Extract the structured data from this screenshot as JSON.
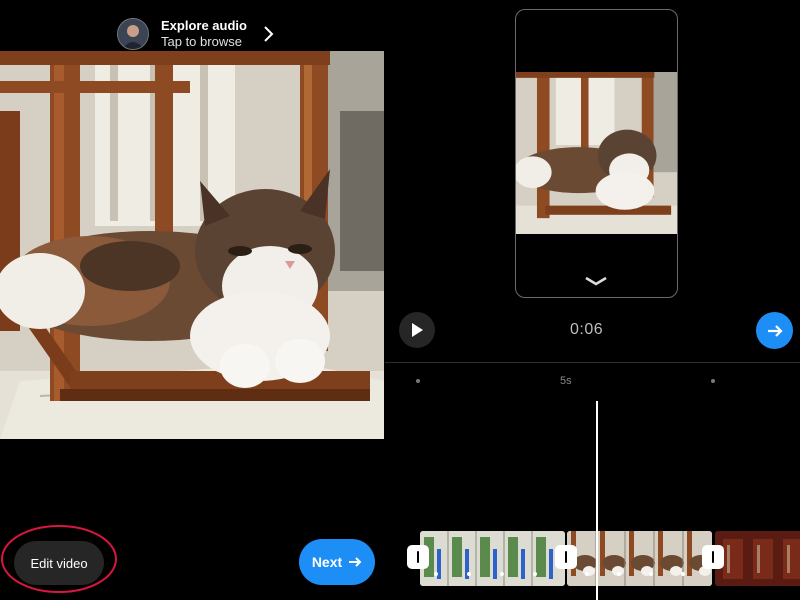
{
  "audio": {
    "title": "Explore audio",
    "subtitle": "Tap to browse"
  },
  "buttons": {
    "edit_video": "Edit video",
    "next": "Next"
  },
  "player": {
    "time": "0:06"
  },
  "timeline": {
    "ruler_label": "5s"
  },
  "icons": {
    "play": "play-icon",
    "next_arrow": "arrow-right-icon",
    "expand": "chevron-down-icon",
    "audio_chevron": "chevron-right-icon"
  },
  "colors": {
    "accent_blue": "#1d8ef5",
    "annotation_red": "#d8163f",
    "background": "#000000",
    "pill_gray": "#262626"
  }
}
